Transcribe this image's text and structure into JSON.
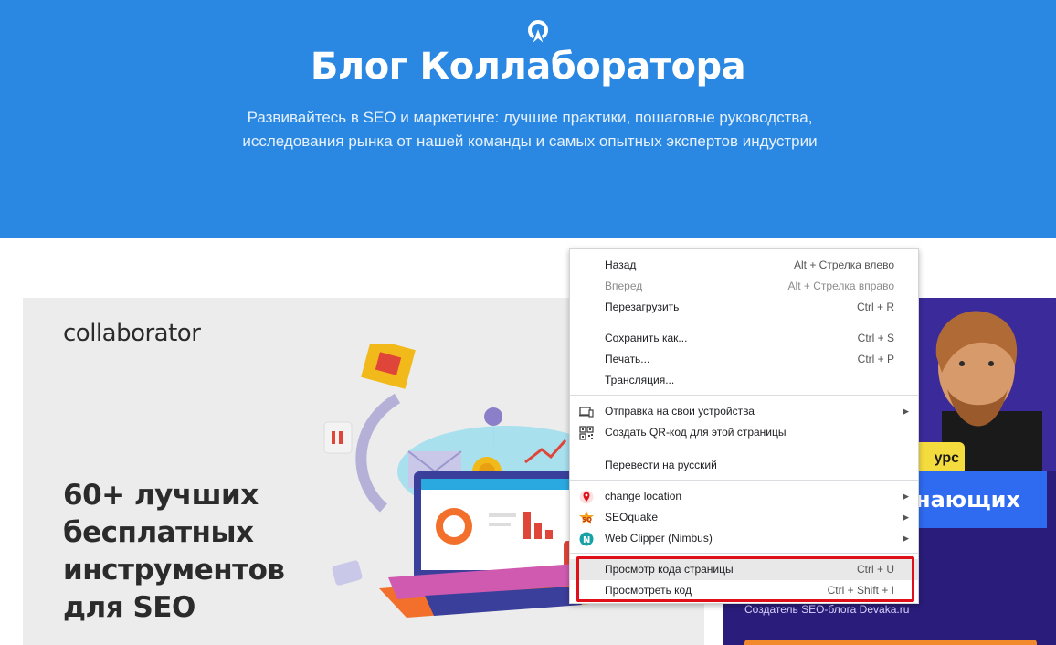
{
  "hero": {
    "title": "Блог Коллаборатора",
    "subtitle_line1": "Развивайтесь в SEO и маркетинге: лучшие практики, пошаговые руководства,",
    "subtitle_line2": "исследования рынка от нашей команды и самых опытных экспертов индустрии",
    "background": "#2a88e3"
  },
  "left_card": {
    "brand": "collaborator",
    "headline_lines": [
      "60+ лучших",
      "бесплатных",
      "инструментов",
      "для SEO"
    ]
  },
  "right_card": {
    "badge_text": "урс",
    "banner_text": "нающих",
    "author": "Создатель SEO-блога Devaka.ru"
  },
  "context_menu": {
    "items": [
      {
        "label": "Назад",
        "shortcut": "Alt + Стрелка влево",
        "disabled": false
      },
      {
        "label": "Вперед",
        "shortcut": "Alt + Стрелка вправо",
        "disabled": true
      },
      {
        "label": "Перезагрузить",
        "shortcut": "Ctrl + R",
        "disabled": false
      },
      {
        "label": "Сохранить как...",
        "shortcut": "Ctrl + S",
        "disabled": false
      },
      {
        "label": "Печать...",
        "shortcut": "Ctrl + P",
        "disabled": false
      },
      {
        "label": "Трансляция...",
        "shortcut": "",
        "disabled": false
      },
      {
        "label": "Отправка на свои устройства",
        "icon": "devices-icon",
        "submenu": true
      },
      {
        "label": "Создать QR-код для этой страницы",
        "icon": "qr-code-icon"
      },
      {
        "label": "Перевести на русский"
      },
      {
        "label": "change location",
        "icon": "location-pin-icon",
        "submenu": true
      },
      {
        "label": "SEOquake",
        "icon": "seoquake-icon",
        "submenu": true
      },
      {
        "label": "Web Clipper (Nimbus)",
        "icon": "nimbus-icon",
        "submenu": true
      },
      {
        "label": "Просмотр кода страницы",
        "shortcut": "Ctrl + U",
        "highlighted": true
      },
      {
        "label": "Просмотреть код",
        "shortcut": "Ctrl + Shift + I"
      }
    ],
    "highlight_color": "#e0101a"
  }
}
